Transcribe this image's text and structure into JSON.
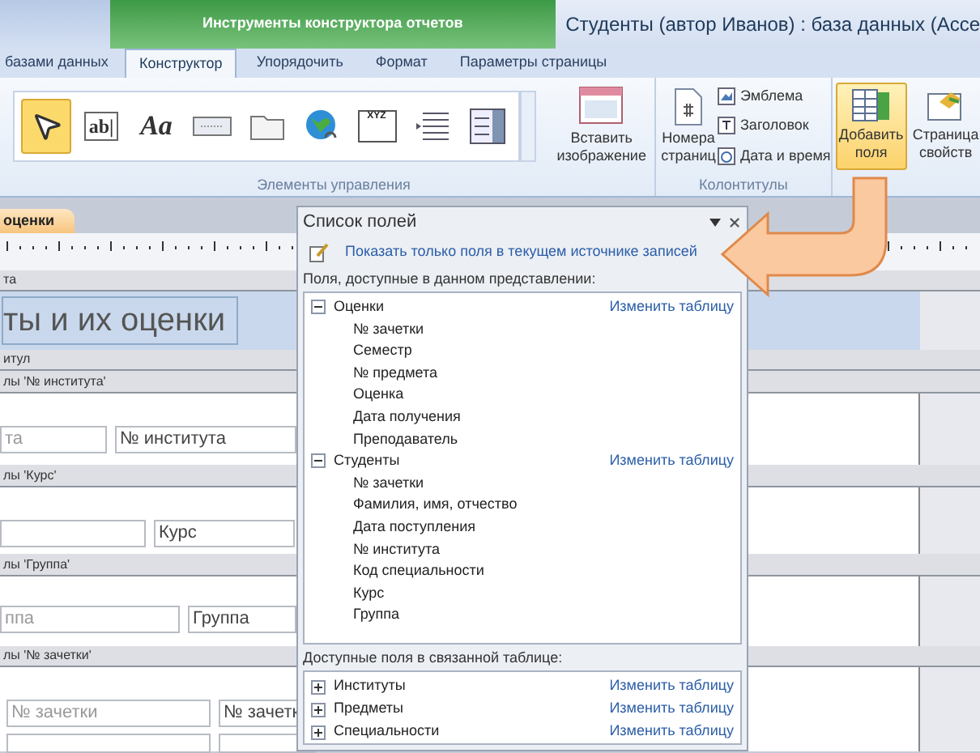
{
  "window": {
    "title": "Студенты (автор Иванов) : база данных (Acce",
    "context_group": "Инструменты конструктора отчетов"
  },
  "tabs": [
    {
      "label": "базами данных",
      "selected": false
    },
    {
      "label": "Конструктор",
      "selected": true
    },
    {
      "label": "Упорядочить",
      "selected": false
    },
    {
      "label": "Формат",
      "selected": false
    },
    {
      "label": "Параметры страницы",
      "selected": false
    }
  ],
  "ribbon": {
    "controls": {
      "label": "Элементы управления",
      "tools": [
        {
          "kind": "pointer",
          "selected": true
        },
        {
          "kind": "textbox",
          "glyph": "ab|",
          "selected": false
        },
        {
          "kind": "label",
          "glyph": "Aa",
          "selected": false
        },
        {
          "kind": "button",
          "selected": false
        },
        {
          "kind": "tab",
          "selected": false
        },
        {
          "kind": "hyperlink",
          "selected": false
        },
        {
          "kind": "frame",
          "glyph": "XYZ",
          "selected": false
        },
        {
          "kind": "list",
          "selected": false
        },
        {
          "kind": "combo",
          "selected": false
        }
      ],
      "insert_image": [
        "Вставить",
        "изображение"
      ]
    },
    "header_footer": {
      "label": "Колонтитулы",
      "page_numbers": [
        "Номера",
        "страниц"
      ],
      "items": [
        {
          "kind": "logo",
          "label": "Эмблема"
        },
        {
          "kind": "title",
          "label": "Заголовок"
        },
        {
          "kind": "date",
          "label": "Дата и время"
        }
      ]
    },
    "add_fields": {
      "label": [
        "Добавить",
        "поля"
      ],
      "selected": true
    },
    "property_sheet": {
      "label": [
        "Страница",
        "свойств"
      ],
      "selected": false
    }
  },
  "report": {
    "tab": "оценки",
    "sections": [
      {
        "kind": "band",
        "text": "та"
      },
      {
        "kind": "title",
        "text": "ты и их оценки"
      },
      {
        "kind": "band",
        "text": "итул"
      },
      {
        "kind": "band",
        "text": "лы '№ института'"
      },
      {
        "kind": "fields",
        "label": "та",
        "value": "№ института"
      },
      {
        "kind": "band",
        "text": "лы 'Курс'"
      },
      {
        "kind": "fields",
        "value": "Курс"
      },
      {
        "kind": "band",
        "text": "лы 'Группа'"
      },
      {
        "kind": "fields",
        "label": "ппа",
        "value": "Группа"
      },
      {
        "kind": "band",
        "text": "лы '№ зачетки'"
      },
      {
        "kind": "fields",
        "label": "№ зачетки",
        "value": "№ зачетк"
      }
    ]
  },
  "field_list": {
    "title": "Список полей",
    "show_current_link": "Показать только поля в текущем источнике записей",
    "available_label": "Поля, доступные в данном представлении:",
    "tables": [
      {
        "name": "Оценки",
        "expanded": true,
        "edit_link": "Изменить таблицу",
        "fields": [
          "№ зачетки",
          "Семестр",
          "№ предмета",
          "Оценка",
          "Дата получения",
          "Преподаватель"
        ]
      },
      {
        "name": "Студенты",
        "expanded": true,
        "edit_link": "Изменить таблицу",
        "fields": [
          "№ зачетки",
          "Фамилия, имя, отчество",
          "Дата поступления",
          "№ института",
          "Код специальности",
          "Курс",
          "Группа"
        ]
      }
    ],
    "related_label": "Доступные поля в связанной таблице:",
    "related_tables": [
      {
        "name": "Институты",
        "expanded": false,
        "edit_link": "Изменить таблицу"
      },
      {
        "name": "Предметы",
        "expanded": false,
        "edit_link": "Изменить таблицу"
      },
      {
        "name": "Специальности",
        "expanded": false,
        "edit_link": "Изменить таблицу"
      }
    ]
  }
}
